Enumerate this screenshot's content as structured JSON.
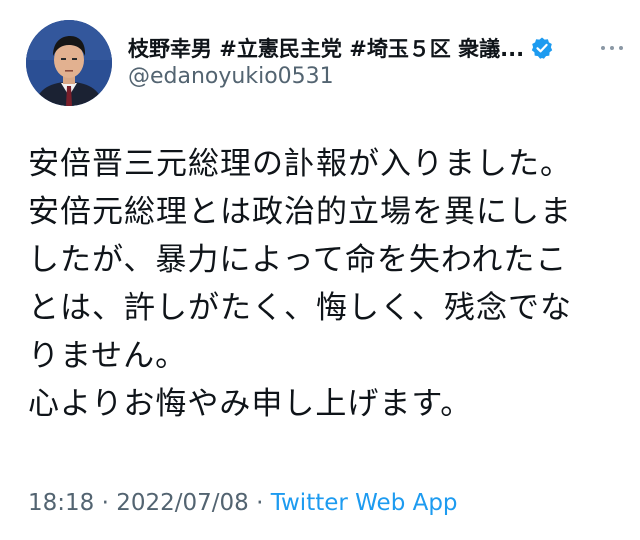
{
  "header": {
    "display_name": "枝野幸男 #立憲民主党 #埼玉５区 衆議...",
    "handle": "@edanoyukio0531",
    "verified": true,
    "accent_color": "#1d9bf0"
  },
  "tweet": {
    "lines": [
      "安倍晋三元総理の訃報が入りました。",
      "安倍元総理とは政治的立場を異にしま",
      "したが、暴力によって命を失われたこ",
      "とは、許しがたく、悔しく、残念でな",
      "りません。",
      "心よりお悔やみ申し上げます。"
    ]
  },
  "meta": {
    "time": "18:18",
    "separator1": " · ",
    "date": "2022/07/08",
    "separator2": " · ",
    "source": "Twitter Web App"
  },
  "icons": {
    "avatar": "profile-photo",
    "verified": "verified-badge-icon",
    "more": "more-options-icon"
  }
}
